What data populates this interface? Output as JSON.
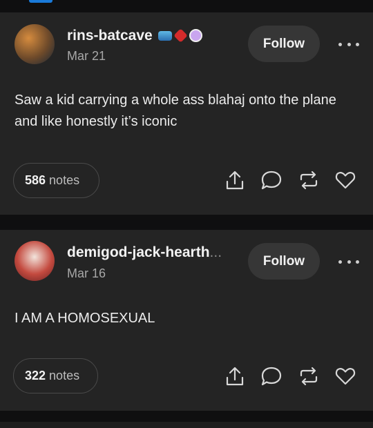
{
  "posts": [
    {
      "username": "rins-batcave",
      "date": "Mar 21",
      "follow_label": "Follow",
      "text": "Saw a kid carrying a whole ass blahaj onto the plane and like honestly it’s iconic",
      "notes_count": "586",
      "notes_label": "notes",
      "badges": [
        "shark-badge-icon",
        "red-badge-icon",
        "cupcake-badge-icon"
      ]
    },
    {
      "username": "demigod-jack-hearth",
      "username_overflow": "...",
      "date": "Mar 16",
      "follow_label": "Follow",
      "text": "I AM A HOMOSEXUAL",
      "notes_count": "322",
      "notes_label": "notes"
    }
  ],
  "icons": [
    "share-icon",
    "reply-icon",
    "reblog-icon",
    "like-icon",
    "more-options-icon"
  ],
  "colors": {
    "background": "#0f0f10",
    "card": "#242424",
    "button": "#363636",
    "accent": "#1a7ad9"
  }
}
